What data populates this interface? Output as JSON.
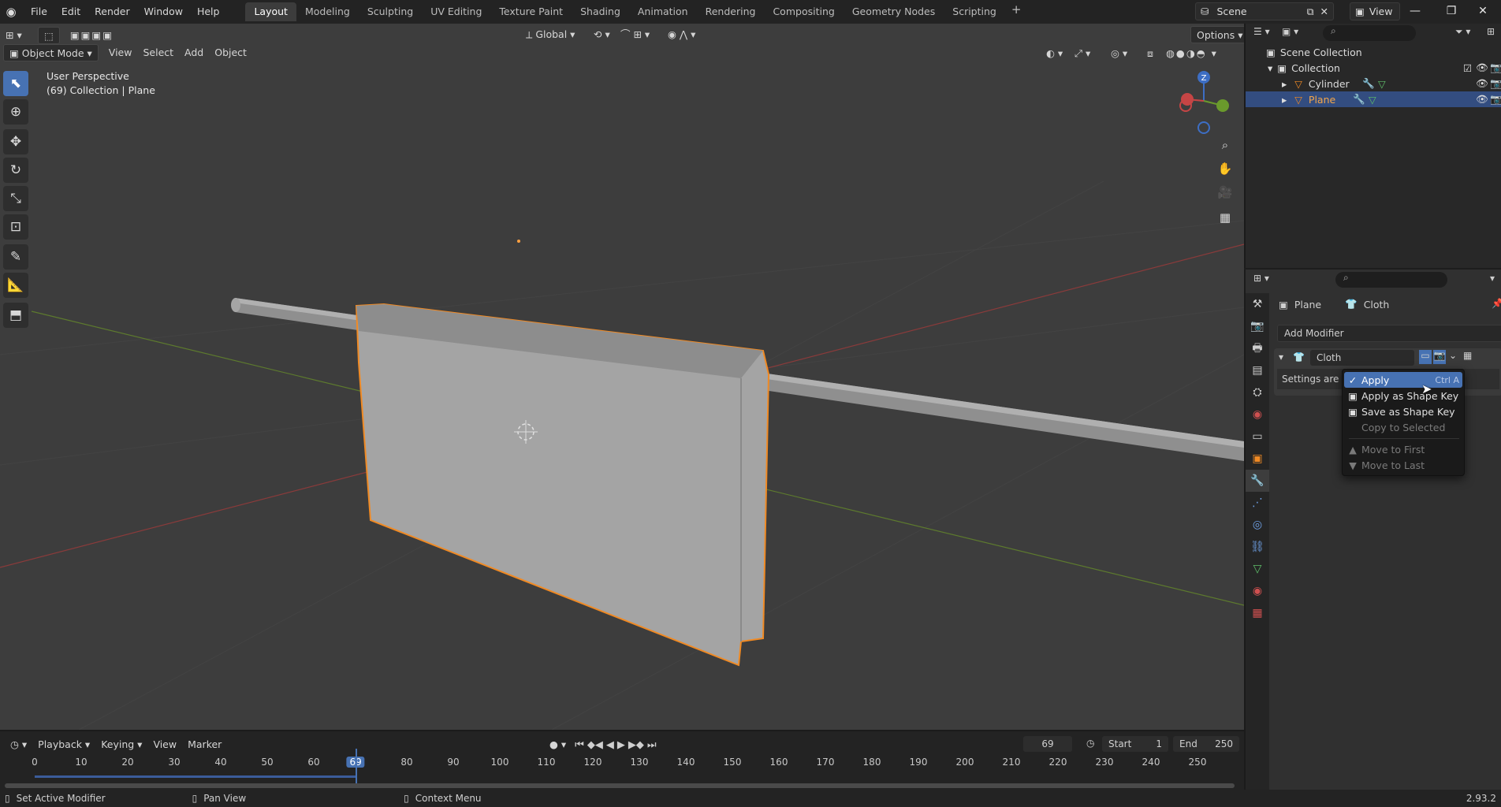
{
  "menubar": {
    "items": [
      "File",
      "Edit",
      "Render",
      "Window",
      "Help"
    ],
    "workspaces": [
      "Layout",
      "Modeling",
      "Sculpting",
      "UV Editing",
      "Texture Paint",
      "Shading",
      "Animation",
      "Rendering",
      "Compositing",
      "Geometry Nodes",
      "Scripting"
    ],
    "active_workspace": "Layout",
    "scene": "Scene",
    "view_layer": "View"
  },
  "viewport_header": {
    "mode": "Object Mode",
    "menus": [
      "View",
      "Select",
      "Add",
      "Object"
    ],
    "transform_orientation": "Global",
    "options": "Options"
  },
  "viewport": {
    "perspective": "User Perspective",
    "context": "(69) Collection | Plane"
  },
  "outliner": {
    "items": [
      {
        "label": "Scene Collection"
      },
      {
        "label": "Collection"
      },
      {
        "label": "Cylinder"
      },
      {
        "label": "Plane"
      }
    ]
  },
  "properties": {
    "breadcrumb_object": "Plane",
    "breadcrumb_modifier": "Cloth",
    "add_modifier": "Add Modifier",
    "modifier_name": "Cloth",
    "settings_text": "Settings are insi"
  },
  "context_menu": {
    "items": [
      {
        "label": "Apply",
        "shortcut": "Ctrl A"
      },
      {
        "label": "Apply as Shape Key"
      },
      {
        "label": "Save as Shape Key"
      },
      {
        "label": "Copy to Selected"
      },
      {
        "label": "Move to First"
      },
      {
        "label": "Move to Last"
      }
    ]
  },
  "timeline": {
    "menus": [
      "Playback",
      "Keying",
      "View",
      "Marker"
    ],
    "current_frame": "69",
    "start_label": "Start",
    "start": "1",
    "end_label": "End",
    "end": "250",
    "ticks": [
      "0",
      "10",
      "20",
      "30",
      "40",
      "50",
      "60",
      "69",
      "80",
      "90",
      "100",
      "110",
      "120",
      "130",
      "140",
      "150",
      "160",
      "170",
      "180",
      "190",
      "200",
      "210",
      "220",
      "230",
      "240",
      "250"
    ]
  },
  "statusbar": {
    "left": "Set Active Modifier",
    "middle": "Pan View",
    "right": "Context Menu",
    "version": "2.93.2"
  },
  "colors": {
    "accent": "#4772b3",
    "selection_outline": "#f08a24"
  }
}
